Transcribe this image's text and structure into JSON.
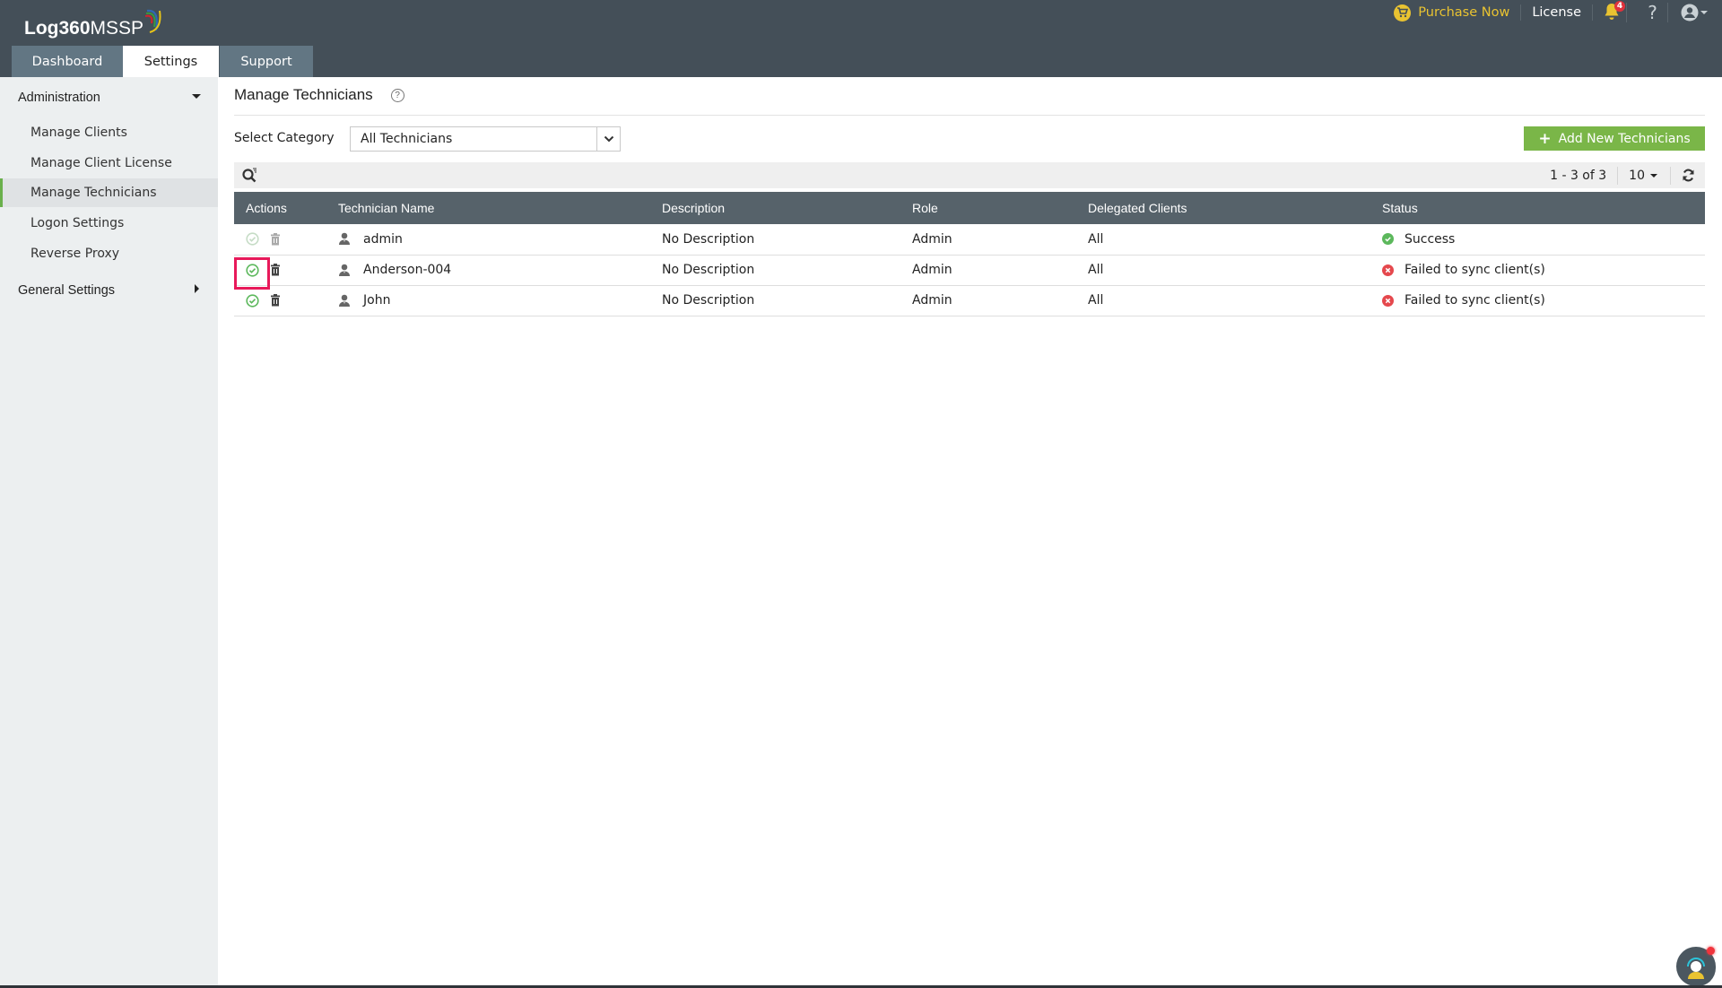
{
  "app": {
    "logo_bold": "Log360",
    "logo_rest": " MSSP"
  },
  "nav_tabs": [
    {
      "label": "Dashboard",
      "active": false
    },
    {
      "label": "Settings",
      "active": true
    },
    {
      "label": "Support",
      "active": false
    }
  ],
  "topbar": {
    "purchase_label": "Purchase Now",
    "license_label": "License",
    "notification_count": "4",
    "help_label": "?"
  },
  "sidebar": {
    "sections": [
      {
        "label": "Administration",
        "expanded": true
      },
      {
        "label": "General Settings",
        "expanded": false
      }
    ],
    "items": [
      {
        "label": "Manage Clients",
        "active": false
      },
      {
        "label": "Manage Client License",
        "active": false
      },
      {
        "label": "Manage Technicians",
        "active": true
      },
      {
        "label": "Logon Settings",
        "active": false
      },
      {
        "label": "Reverse Proxy",
        "active": false
      }
    ]
  },
  "page": {
    "title": "Manage Technicians",
    "help_icon": "?",
    "category_label": "Select Category",
    "category_value": "All Technicians",
    "add_button_label": "Add New Technicians",
    "pagination": "1 - 3 of 3",
    "per_page": "10"
  },
  "table": {
    "columns": [
      "Actions",
      "Technician Name",
      "Description",
      "Role",
      "Delegated Clients",
      "Status"
    ],
    "rows": [
      {
        "name": "admin",
        "description": "No Description",
        "role": "Admin",
        "delegated": "All",
        "status": "Success",
        "status_type": "success",
        "actions_enabled": false
      },
      {
        "name": "Anderson-004",
        "description": "No Description",
        "role": "Admin",
        "delegated": "All",
        "status": "Failed to sync client(s)",
        "status_type": "failed",
        "actions_enabled": true
      },
      {
        "name": "John",
        "description": "No Description",
        "role": "Admin",
        "delegated": "All",
        "status": "Failed to sync client(s)",
        "status_type": "failed",
        "actions_enabled": true
      }
    ]
  },
  "colors": {
    "topbar": "#444f58",
    "accent_green": "#7ab648",
    "success": "#5cb85c",
    "failed": "#e5484d",
    "highlight": "#e8195a",
    "purchase": "#e9c331"
  }
}
